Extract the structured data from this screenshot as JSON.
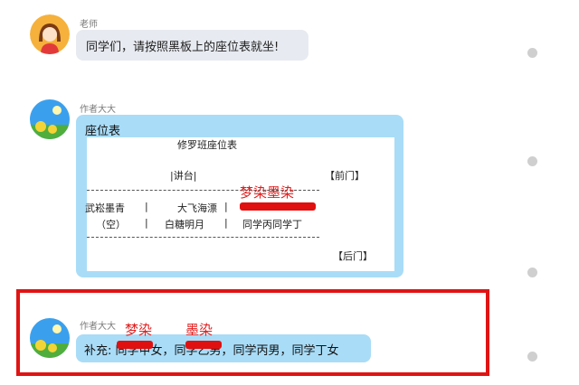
{
  "messages": [
    {
      "sender": "老师",
      "text": "同学们，请按照黑板上的座位表就坐!"
    },
    {
      "sender": "作者大大",
      "label": "座位表"
    },
    {
      "sender": "作者大大",
      "text": "补充: 同学甲女，同学乙男，同学丙男，同学丁女"
    }
  ],
  "seat_table": {
    "title": "修罗班座位表",
    "podium": "|讲台|",
    "front_door": "【前门】",
    "back_door": "【后门】",
    "row1": [
      "武崧墨青",
      "|",
      "大飞海漂",
      "|"
    ],
    "row2": [
      "（空）",
      "|",
      "白糖明月",
      "|",
      "同学丙同学丁"
    ]
  },
  "annotations": {
    "table_anno": "梦染墨染",
    "supp_anno_1": "梦染",
    "supp_anno_2": "墨染"
  },
  "colors": {
    "bubble_blue": "#a9dcf7",
    "bubble_gray": "#e7eaf0",
    "highlight_red": "#e01414"
  }
}
